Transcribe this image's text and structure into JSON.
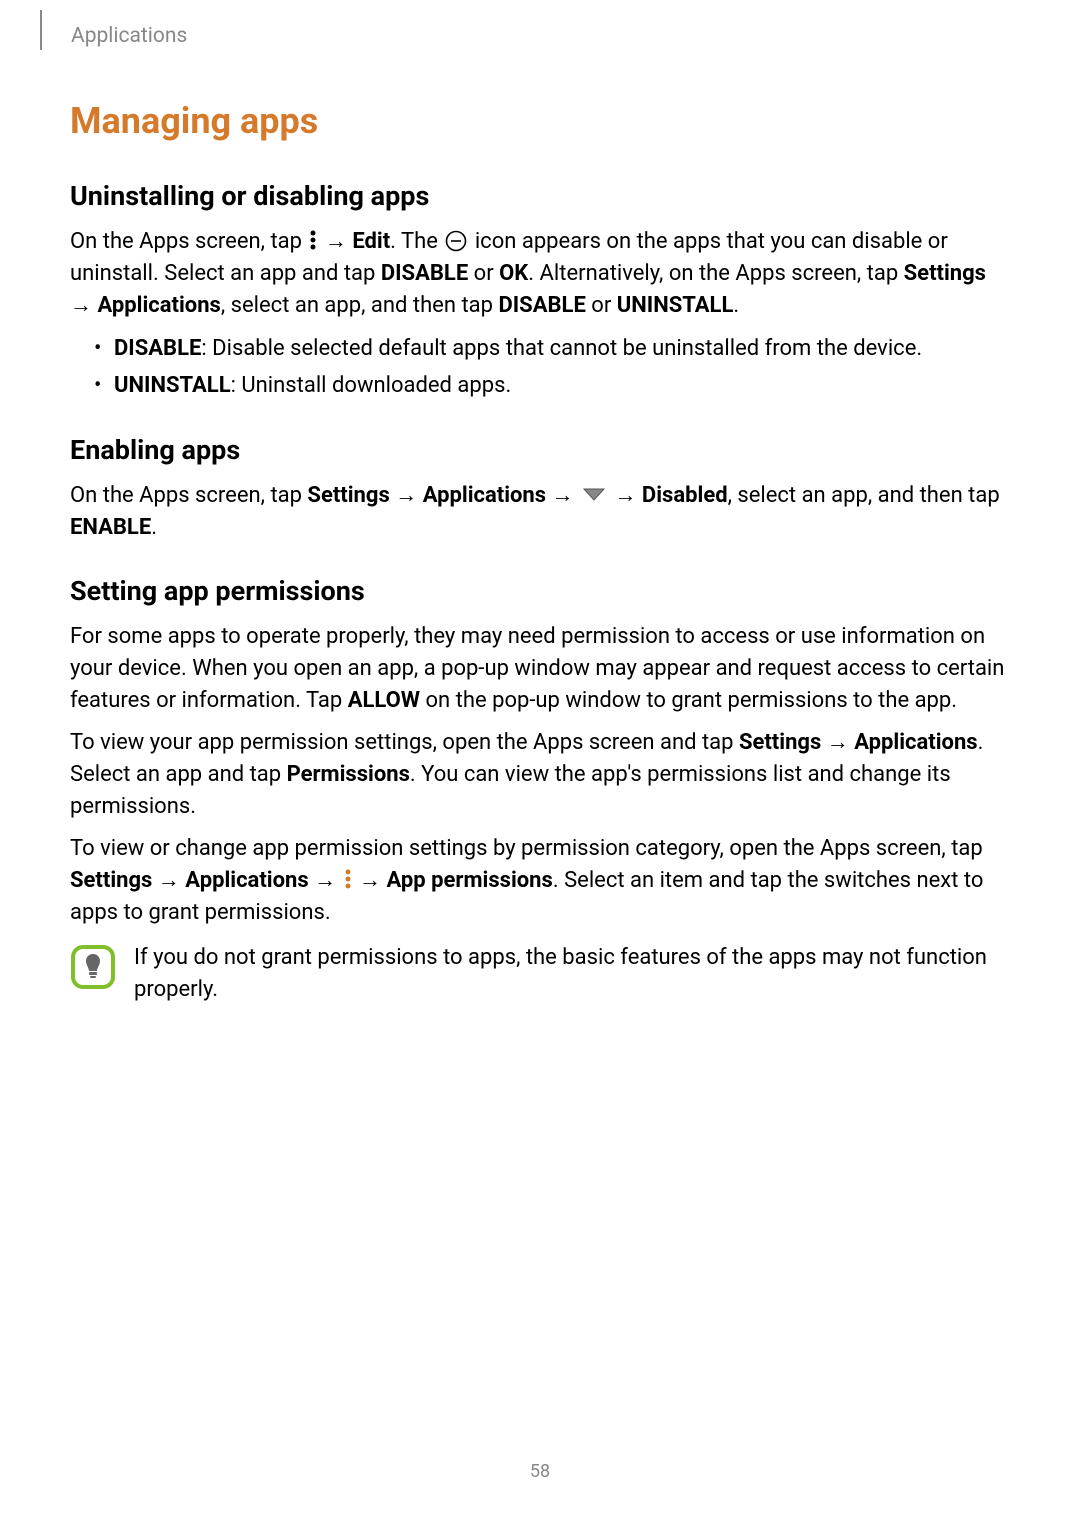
{
  "header": {
    "breadcrumb": "Applications"
  },
  "main_heading": "Managing apps",
  "section1": {
    "heading": "Uninstalling or disabling apps",
    "p1a": "On the Apps screen, tap ",
    "p1b": " → ",
    "edit": "Edit",
    "p1c": ". The ",
    "p1d": " icon appears on the apps that you can disable or uninstall. Select an app and tap ",
    "disable": "DISABLE",
    "p1e": " or ",
    "ok": "OK",
    "p1f": ". Alternatively, on the Apps screen, tap ",
    "settings": "Settings",
    "arrow": " → ",
    "applications": "Applications",
    "p1g": ", select an app, and then tap ",
    "disable2": "DISABLE",
    "p1h": " or ",
    "uninstall": "UNINSTALL",
    "p1i": ".",
    "bullet1_strong": "DISABLE",
    "bullet1_rest": ": Disable selected default apps that cannot be uninstalled from the device.",
    "bullet2_strong": "UNINSTALL",
    "bullet2_rest": ": Uninstall downloaded apps."
  },
  "section2": {
    "heading": "Enabling apps",
    "p1a": "On the Apps screen, tap ",
    "settings": "Settings",
    "arrow": " → ",
    "applications": "Applications",
    "arrow2": " → ",
    "arrow3": " → ",
    "disabled": "Disabled",
    "p1b": ", select an app, and then tap ",
    "enable": "ENABLE",
    "p1c": "."
  },
  "section3": {
    "heading": "Setting app permissions",
    "p1": "For some apps to operate properly, they may need permission to access or use information on your device. When you open an app, a pop-up window may appear and request access to certain features or information. Tap ",
    "allow": "ALLOW",
    "p1b": " on the pop-up window to grant permissions to the app.",
    "p2a": "To view your app permission settings, open the Apps screen and tap ",
    "settings": "Settings",
    "arrow": " → ",
    "applications": "Applications",
    "p2b": ". Select an app and tap ",
    "permissions": "Permissions",
    "p2c": ". You can view the app's permissions list and change its permissions.",
    "p3a": "To view or change app permission settings by permission category, open the Apps screen, tap ",
    "settings2": "Settings",
    "arrow2": " → ",
    "applications2": "Applications",
    "arrow3": " → ",
    "arrow4": " → ",
    "app_permissions": "App permissions",
    "p3b": ". Select an item and tap the switches next to apps to grant permissions.",
    "note": "If you do not grant permissions to apps, the basic features of the apps may not function properly."
  },
  "page_number": "58"
}
